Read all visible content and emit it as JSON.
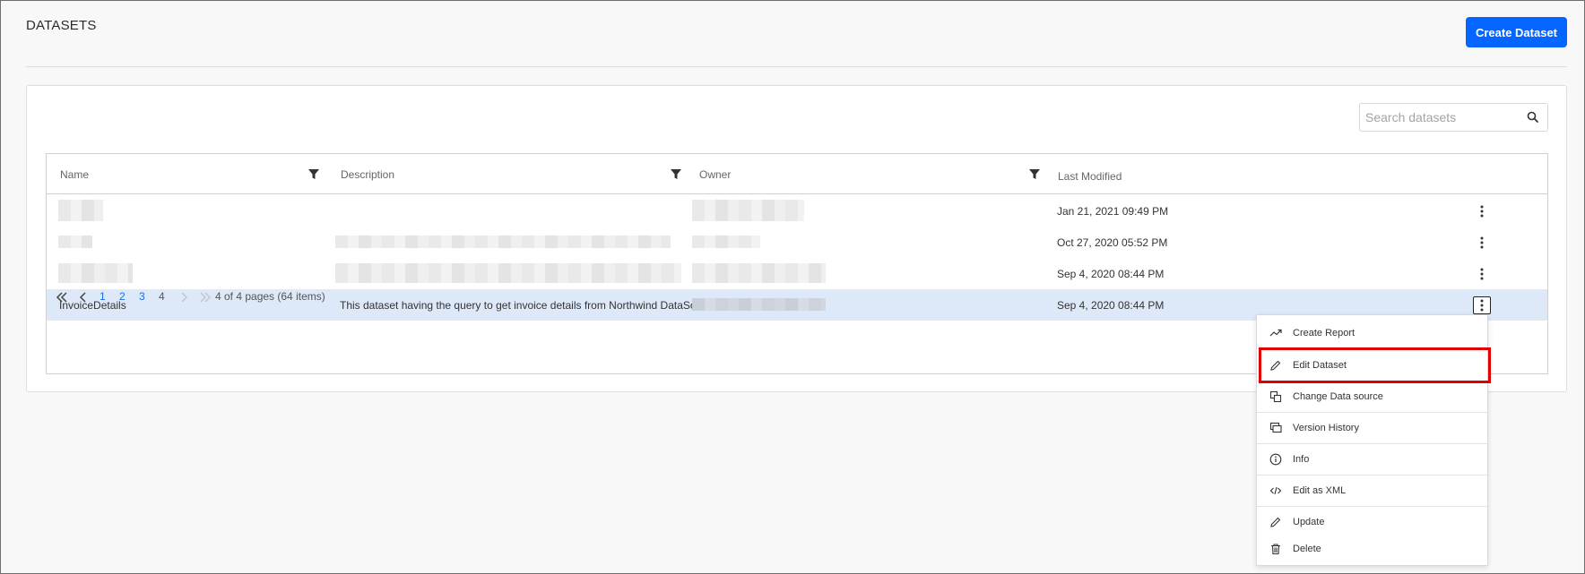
{
  "page": {
    "title": "DATASETS",
    "create_label": "Create Dataset"
  },
  "search": {
    "placeholder": "Search datasets"
  },
  "grid": {
    "columns": [
      "Name",
      "Description",
      "Owner",
      "Last Modified"
    ],
    "rows": [
      {
        "name": "",
        "description": "",
        "owner": "",
        "last_modified": "Jan 21, 2021 09:49 PM"
      },
      {
        "name": "",
        "description": "",
        "owner": "",
        "last_modified": "Oct 27, 2020 05:52 PM"
      },
      {
        "name": "",
        "description": "",
        "owner": "",
        "last_modified": "Sep 4, 2020 08:44 PM"
      },
      {
        "name": "InvoiceDetails",
        "description": "This dataset having the query to get invoice details from Northwind DataSource.",
        "owner": "",
        "last_modified": "Sep 4, 2020 08:44 PM"
      }
    ]
  },
  "pager": {
    "pages": [
      "1",
      "2",
      "3",
      "4"
    ],
    "current": "4",
    "summary": "4 of 4 pages (64 items)"
  },
  "context_menu": {
    "items": [
      {
        "label": "Create Report",
        "icon": "trending-up-icon"
      },
      {
        "label": "Edit Dataset",
        "icon": "pencil-icon"
      },
      {
        "label": "Change Data source",
        "icon": "copy-icon"
      },
      {
        "label": "Version History",
        "icon": "version-history-icon"
      },
      {
        "label": "Info",
        "icon": "info-icon"
      },
      {
        "label": "Edit as XML",
        "icon": "code-icon"
      },
      {
        "label": "Update",
        "icon": "pencil-icon"
      },
      {
        "label": "Delete",
        "icon": "trash-icon"
      }
    ]
  },
  "colors": {
    "accent": "#0565ff",
    "selected_row": "#dde8f8",
    "highlight_border": "#e00000",
    "link": "#1a6fe8"
  }
}
